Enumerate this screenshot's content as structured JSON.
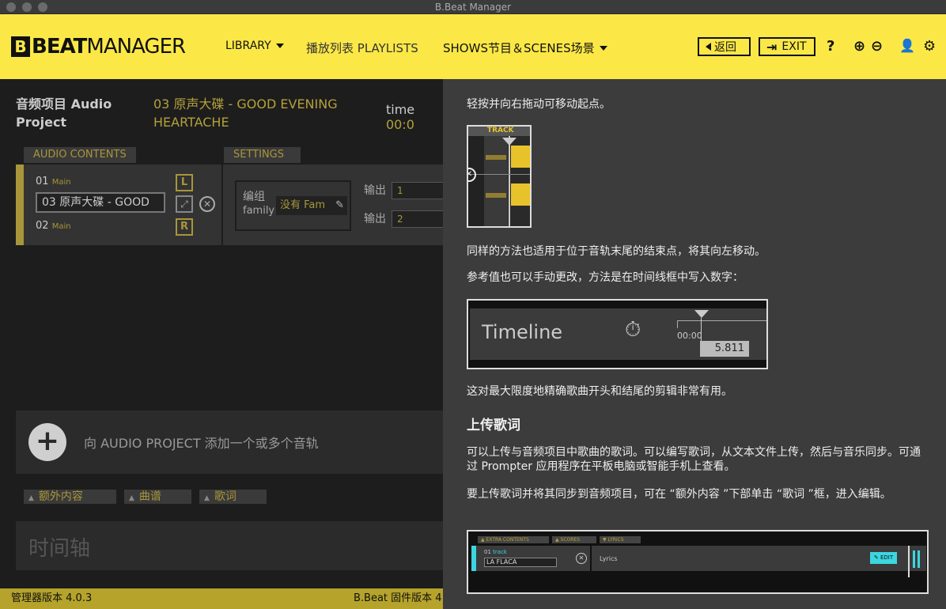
{
  "window": {
    "title": "B.Beat Manager"
  },
  "header": {
    "logo_mark": "B",
    "logo_beat": "BEAT",
    "logo_manager": "MANAGER",
    "nav_library": "LIBRARY",
    "nav_playlists": "播放列表 PLAYLISTS",
    "nav_shows": "SHOWS节目＆SCENES场景",
    "back_label": "返回",
    "exit_label": "EXIT",
    "help_glyph": "?",
    "zoom_in_glyph": "⊕",
    "zoom_out_glyph": "⊖",
    "user_glyph": "👤",
    "gear_glyph": "⚙"
  },
  "project": {
    "title": "音频项目 Audio Project",
    "track_title": "03 原声大碟 - GOOD EVENING HEARTACHE",
    "time_label": "time",
    "time_value": "00:0"
  },
  "tabs": {
    "audio_contents": "AUDIO CONTENTS",
    "settings": "SETTINGS"
  },
  "track": {
    "top_num": "01",
    "top_tag": "Main",
    "name": "03 原声大碟 - GOOD",
    "bottom_num": "02",
    "bottom_tag": "Main",
    "left_ch": "L",
    "right_ch": "R"
  },
  "settings_panel": {
    "group_label": "编组",
    "family_label": "family",
    "family_value": "没有 Fam",
    "output_label_1": "输出",
    "output_value_1": "1",
    "output_label_2": "输出",
    "output_value_2": "2"
  },
  "add_track": {
    "label": "向 AUDIO PROJECT 添加一个或多个音轨"
  },
  "subtabs": {
    "extra": "额外内容",
    "scores": "曲谱",
    "lyrics": "歌词"
  },
  "timeline": {
    "label": "时间轴"
  },
  "footer": {
    "manager_version": "管理器版本 4.0.3",
    "firmware_version": "B.Beat 固件版本 4"
  },
  "help": {
    "p1": "轻按并向右拖动可移动起点。",
    "p2": "同样的方法也适用于位于音轨末尾的结束点，将其向左移动。",
    "p3": "参考值也可以手动更改，方法是在时间线框中写入数字：",
    "p4": "这对最大限度地精确歌曲开头和结尾的剪辑非常有用。",
    "h_lyrics": "上传歌词",
    "p5": "可以上传与音频项目中歌曲的歌词。可以编写歌词，从文本文件上传，然后与音乐同步。可通过 Prompter 应用程序在平板电脑或智能手机上查看。",
    "p6": "要上传歌词并将其同步到音频项目，可在 “额外内容 ”下部单击 “歌词 ”框，进入编辑。",
    "img1_track": "TRACK",
    "img2_timeline": "Timeline",
    "img2_start": "00:00",
    "img2_value": "5.811",
    "img3_extra": "EXTRA CONTENTS",
    "img3_scores": "SCORES",
    "img3_lyrics": "LYRICS",
    "img3_num": "01",
    "img3_tag": "track",
    "img3_name": "LA FLACA",
    "img3_lyrics_label": "Lyrics",
    "img3_edit": "EDIT"
  }
}
